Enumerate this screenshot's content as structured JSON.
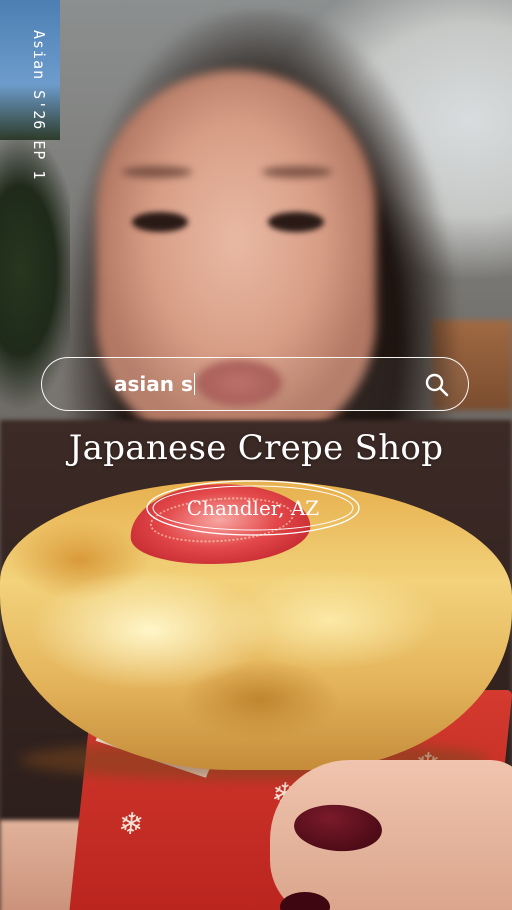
{
  "overlay": {
    "episode_caption": "Asian S'26 EP 1",
    "search": {
      "value": "asian s",
      "icon": "search-icon"
    },
    "title": "Japanese Crepe Shop",
    "location": "Chandler, AZ"
  },
  "colors": {
    "overlay_text": "#ffffff",
    "cup_red": "#c8291f",
    "crepe_gold": "#e9b656",
    "nail_polish": "#4a0a18"
  }
}
